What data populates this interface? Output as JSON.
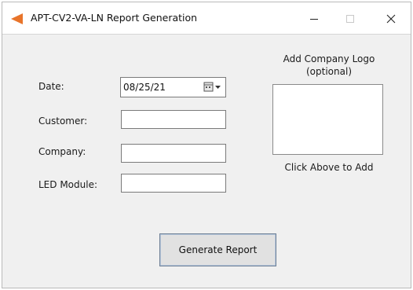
{
  "window": {
    "title": "APT-CV2-VA-LN Report Generation",
    "icon": "orange-triangle-app-icon",
    "controls": [
      "minimize-icon",
      "maximize-icon",
      "close-icon"
    ]
  },
  "form": {
    "date_label": "Date:",
    "date_value": "08/25/21",
    "customer_label": "Customer:",
    "customer_value": "",
    "company_label": "Company:",
    "company_value": "",
    "led_module_label": "LED Module:",
    "led_module_value": ""
  },
  "logo": {
    "caption_line1": "Add Company Logo",
    "caption_line2": "(optional)",
    "hint": "Click Above to Add"
  },
  "actions": {
    "generate_label": "Generate Report"
  },
  "colors": {
    "accent_icon": "#e8742a",
    "button_border": "#6d7f95",
    "client_bg": "#f0f0f0"
  }
}
